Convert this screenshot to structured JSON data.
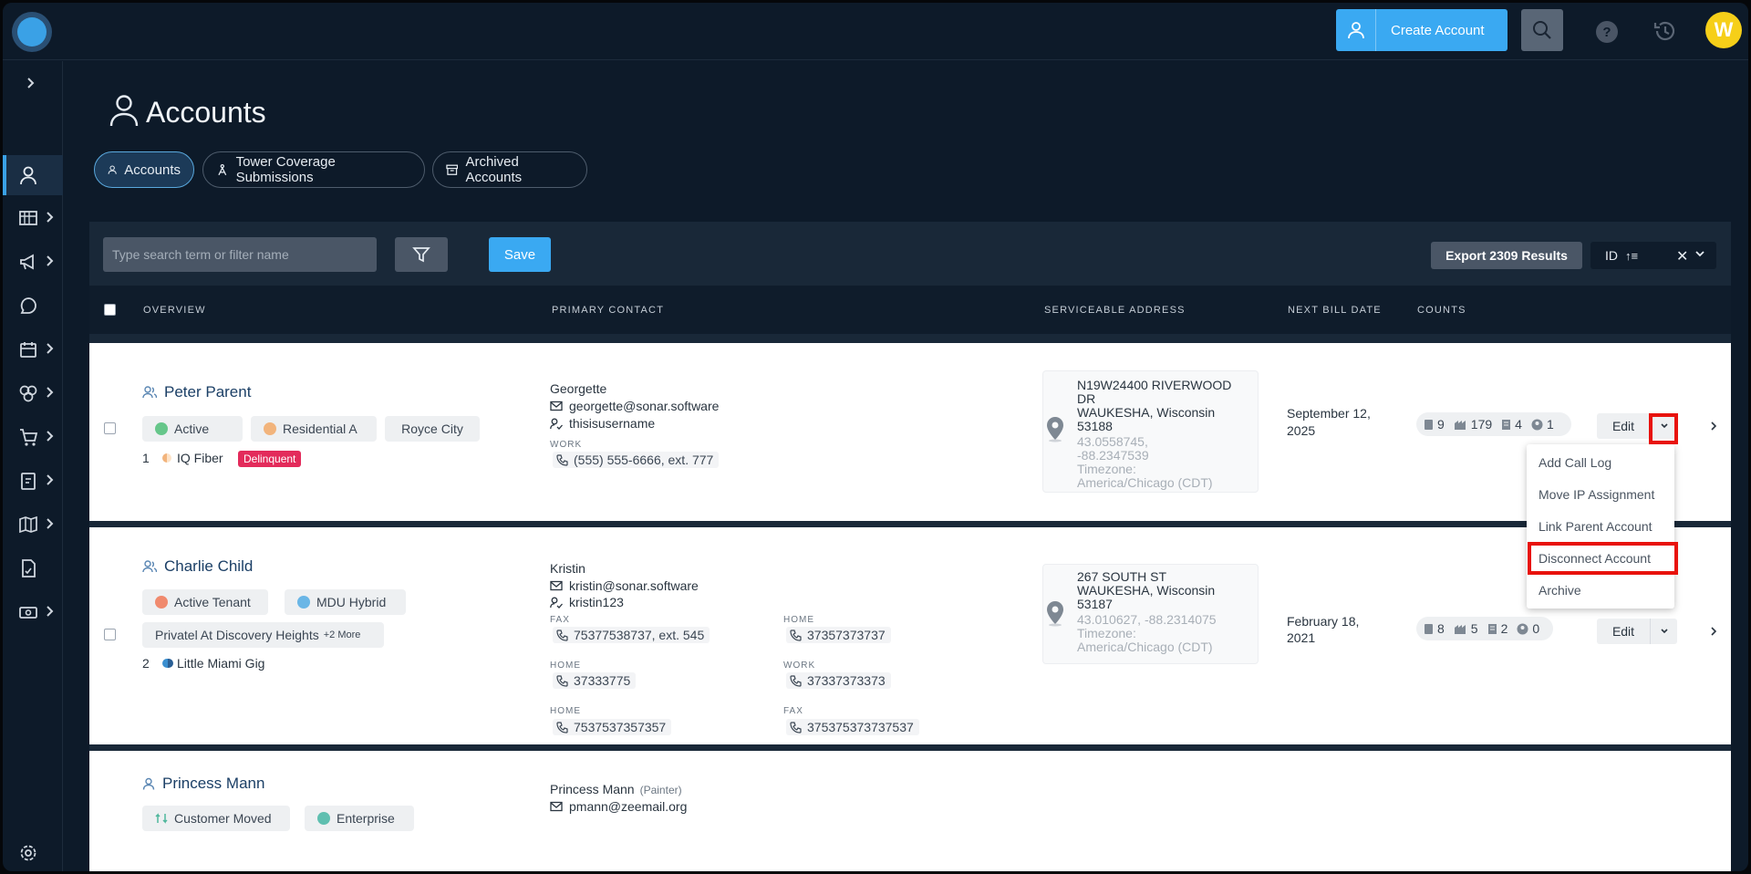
{
  "header": {
    "create_account_label": "Create Account",
    "help_label": "?",
    "avatar_initial": "W"
  },
  "page": {
    "title": "Accounts",
    "tabs": [
      {
        "label": "Accounts"
      },
      {
        "label": "Tower Coverage Submissions"
      },
      {
        "label": "Archived Accounts"
      }
    ]
  },
  "toolbar": {
    "search_placeholder": "Type search term or filter name",
    "save_label": "Save",
    "export_label": "Export 2309 Results",
    "sort_label": "ID",
    "sort_icon": "↑≡",
    "clear_label": "✕"
  },
  "table": {
    "columns": [
      "OVERVIEW",
      "PRIMARY CONTACT",
      "SERVICEABLE ADDRESS",
      "NEXT BILL DATE",
      "COUNTS"
    ]
  },
  "rows": [
    {
      "name": "Peter Parent",
      "pills": [
        {
          "label": "Active",
          "color": "#66c68a"
        },
        {
          "label": "Residential A",
          "color": "#f2b47c"
        },
        {
          "label": "Royce City"
        }
      ],
      "service_count": "1",
      "service_name": "IQ Fiber",
      "badge": "Delinquent",
      "contact_name": "Georgette",
      "email": "georgette@sonar.software",
      "username": "thisisusername",
      "phone_label": "WORK",
      "phone": "(555) 555-6666, ext. 777",
      "address_lines": [
        "N19W24400 RIVERWOOD",
        "DR",
        "WAUKESHA, Wisconsin",
        "53188"
      ],
      "coords": [
        "43.0558745,",
        "-88.2347539"
      ],
      "timezone": [
        "Timezone:",
        "America/Chicago (CDT)"
      ],
      "bill_date": [
        "September 12,",
        "2025"
      ],
      "counts": [
        "9",
        "179",
        "4",
        "1"
      ],
      "edit_label": "Edit"
    },
    {
      "name": "Charlie Child",
      "pills": [
        {
          "label": "Active Tenant",
          "color": "#f08a6e"
        },
        {
          "label": "MDU Hybrid",
          "color": "#6ab6e6"
        },
        {
          "label": "Privatel At Discovery Heights",
          "more": "+2 More"
        }
      ],
      "service_count": "2",
      "service_name": "Little Miami Gig",
      "contact_name": "Kristin",
      "email": "kristin@sonar.software",
      "username": "kristin123",
      "phones": [
        {
          "label": "FAX",
          "value": "75377538737, ext. 545"
        },
        {
          "label": "HOME",
          "value": "37357373737"
        },
        {
          "label": "HOME",
          "value": "37333775"
        },
        {
          "label": "WORK",
          "value": "37337373373"
        },
        {
          "label": "HOME",
          "value": "7537537357357"
        },
        {
          "label": "FAX",
          "value": "375375373737537"
        }
      ],
      "address_lines": [
        "267 SOUTH ST",
        "WAUKESHA, Wisconsin",
        "53187"
      ],
      "coords": [
        "43.010627, -88.2314075"
      ],
      "timezone": [
        "Timezone:",
        "America/Chicago (CDT)"
      ],
      "bill_date": [
        "February 18,",
        "2021"
      ],
      "counts": [
        "8",
        "5",
        "2",
        "0"
      ],
      "edit_label": "Edit"
    },
    {
      "name": "Princess Mann",
      "pills": [
        {
          "label": "Customer Moved",
          "color": "#4fb79c"
        },
        {
          "label": "Enterprise",
          "color": "#5fbfb0"
        }
      ],
      "contact_name": "Princess Mann",
      "contact_role": "(Painter)",
      "email": "pmann@zeemail.org"
    }
  ],
  "menu": {
    "items": [
      "Add Call Log",
      "Move IP Assignment",
      "Link Parent Account",
      "Disconnect Account",
      "Archive"
    ]
  },
  "colors": {
    "accent": "#3aa9f2",
    "highlight": "#e8120c",
    "avatar": "#f6cf19",
    "delinquent": "#e32b5b"
  }
}
